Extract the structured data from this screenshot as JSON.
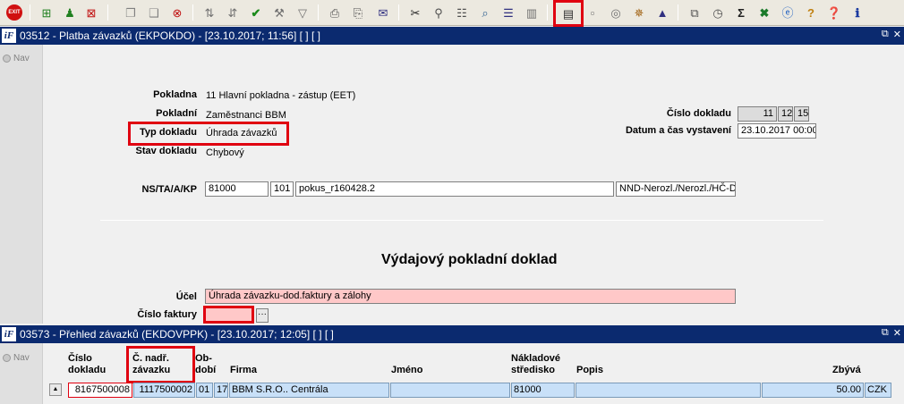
{
  "toolbar": {
    "exit_label": "EXIT"
  },
  "window1": {
    "title": "03512 - Platba závazků (EKPOKDO) - [23.10.2017; 11:56] [ ] [ ]",
    "nav_label": "Nav",
    "fields": {
      "pokladna_label": "Pokladna",
      "pokladna_value": "11 Hlavní pokladna - zástup (EET)",
      "pokladni_label": "Pokladní",
      "pokladni_value": "Zaměstnanci BBM",
      "typ_label": "Typ dokladu",
      "typ_value": "Úhrada závazků",
      "stav_label": "Stav dokladu",
      "stav_value": "Chybový",
      "cislo_label": "Číslo dokladu",
      "cislo_parts": [
        "11",
        "12",
        "15"
      ],
      "datum_label": "Datum a čas vystavení",
      "datum_value": "23.10.2017 00:00",
      "ns_label": "NS/TA/A/KP",
      "ns_value": "81000",
      "ta_value": "101",
      "a_value": "pokus_r160428.2",
      "kp_value": "NND-Nerozl./Nerozl./HČ-Do"
    },
    "heading": "Výdajový pokladní doklad",
    "ucel_label": "Účel",
    "ucel_value": "Úhrada závazku-dod.faktury a zálohy",
    "faktura_label": "Číslo faktury",
    "faktura_value": "",
    "dots_label": "···"
  },
  "window2": {
    "title": "03573 - Přehled závazků (EKDOVPPK) - [23.10.2017; 12:05] [ ] [ ]",
    "nav_label": "Nav",
    "columns": {
      "cislo_1": "Číslo",
      "cislo_2": "dokladu",
      "nadr_1": "Č. nadř.",
      "nadr_2": "závazku",
      "obdobi_1": "Ob-",
      "obdobi_2": "dobí",
      "firma": "Firma",
      "jmeno": "Jméno",
      "nakl_1": "Nákladové",
      "nakl_2": "středisko",
      "popis": "Popis",
      "zbyva": "Zbývá"
    },
    "row": {
      "cislo": "8167500008",
      "nadr": "1117500002",
      "obd1": "01",
      "obd2": "17",
      "firma": "BBM S.R.O.. Centrála",
      "jmeno": "",
      "stredisko": "81000",
      "popis": "",
      "zbyva": "50.00",
      "mena": "CZK"
    }
  },
  "colors": {
    "titlebar": "#0b2a6f",
    "highlight": "#e00010",
    "grid_cell": "#c8e0f8",
    "pink_field": "#ffc8c8"
  }
}
